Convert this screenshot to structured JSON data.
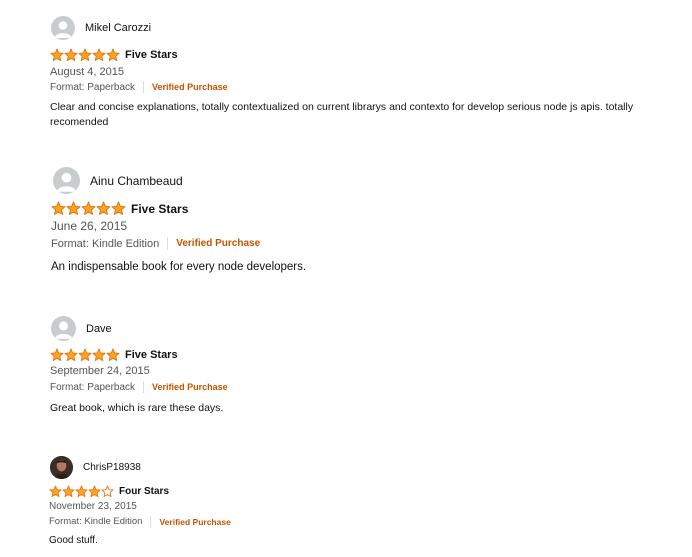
{
  "reviews": [
    {
      "name": "Mikel Carozzi",
      "avatar": "default-avatar-icon",
      "rating": 5,
      "title": "Five Stars",
      "date": "August 4, 2015",
      "format": "Format: Paperback",
      "verified": "Verified Purchase",
      "text": "Clear and concise explanations, totally contextualized on current librarys and contexto for develop serious node js apis. totally recomended"
    },
    {
      "name": "Ainu Chambeaud",
      "avatar": "default-avatar-icon",
      "rating": 5,
      "title": "Five Stars",
      "date": "June 26, 2015",
      "format": "Format: Kindle Edition",
      "verified": "Verified Purchase",
      "text": "An indispensable book for every node developers."
    },
    {
      "name": "Dave",
      "avatar": "default-avatar-icon",
      "rating": 5,
      "title": "Five Stars",
      "date": "September 24, 2015",
      "format": "Format: Paperback",
      "verified": "Verified Purchase",
      "text": "Great book, which is rare these days."
    },
    {
      "name": "ChrisP18938",
      "avatar": "user-photo",
      "rating": 4,
      "title": "Four Stars",
      "date": "November 23, 2015",
      "format": "Format: Kindle Edition",
      "verified": "Verified Purchase",
      "text": "Good stuff."
    }
  ],
  "colors": {
    "star_fill": "#ffa41c",
    "star_stroke": "#de7921",
    "verified": "#c45500",
    "avatar_bg": "#c8ccce"
  }
}
